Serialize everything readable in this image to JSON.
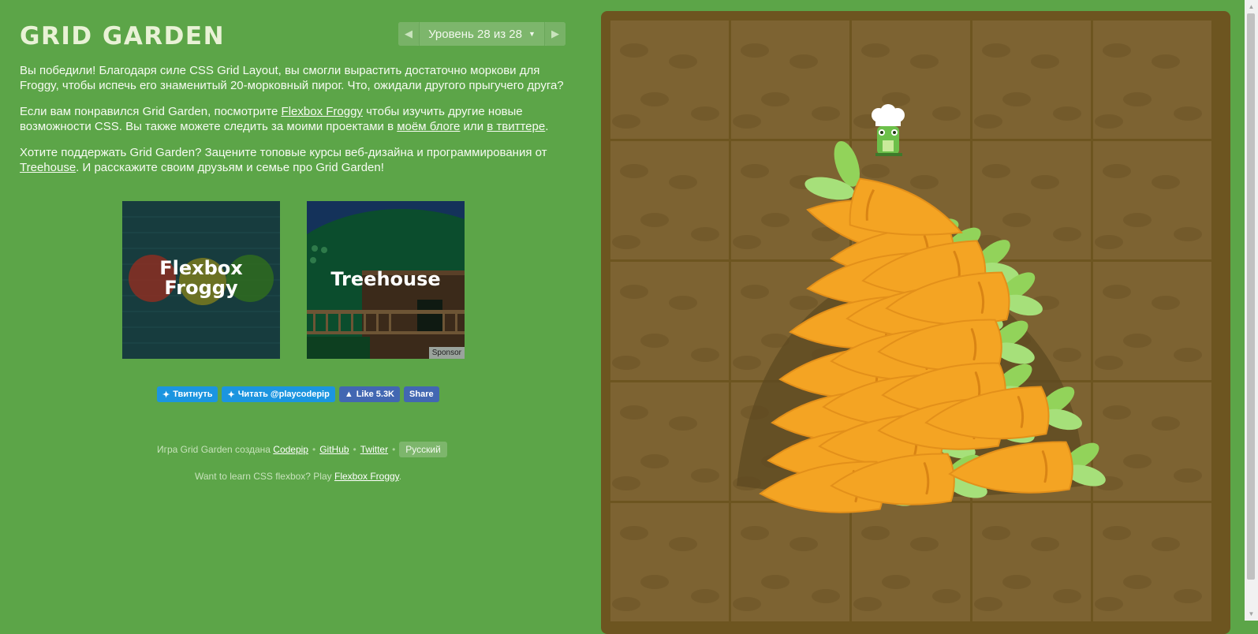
{
  "header": {
    "title": "GRID GARDEN",
    "level_text": "Уровень 28 из 28",
    "prev_icon": "triangle-left-icon",
    "next_icon": "triangle-right-icon",
    "dropdown_icon": "caret-down-icon"
  },
  "content": {
    "p1": "Вы победили! Благодаря силе CSS Grid Layout, вы смогли вырастить достаточно моркови для Froggy, чтобы испечь его знаменитый 20-морковный пирог. Что, ожидали другого прыгучего друга?",
    "p2_a": "Если вам понравился Grid Garden, посмотрите ",
    "p2_link1": "Flexbox Froggy",
    "p2_b": " чтобы изучить другие новые возможности CSS. Вы также можете следить за моими проектами в ",
    "p2_link2": "моём блоге",
    "p2_c": " или ",
    "p2_link3": "в твиттере",
    "p2_d": ".",
    "p3_a": "Хотите поддержать Grid Garden? Зацените топовые курсы веб-дизайна и программирования от ",
    "p3_link": "Treehouse",
    "p3_b": ". И расскажите своим друзьям и семье про Grid Garden!"
  },
  "promos": {
    "froggy_line1": "Flexbox",
    "froggy_line2": "Froggy",
    "treehouse_title": "Treehouse",
    "sponsor_label": "Sponsor"
  },
  "social": {
    "tweet": "Твитнуть",
    "follow": "Читать @playcodepip",
    "like": "Like 5.3K",
    "share": "Share"
  },
  "footer": {
    "credit": "Игра Grid Garden создана",
    "codepip": "Codepip",
    "github": "GitHub",
    "twitter": "Twitter",
    "language": "Русский",
    "learn_text": "Want to learn CSS flexbox? Play",
    "froggy_link": "Flexbox Froggy"
  },
  "garden": {
    "columns": 5,
    "rows": 5,
    "carrot_count": 20,
    "colors": {
      "page_bg": "#5ca548",
      "soil": "#7d6332",
      "soil_border": "#6d5520",
      "carrot": "#f4a423",
      "leaf": "#92d35a"
    }
  }
}
